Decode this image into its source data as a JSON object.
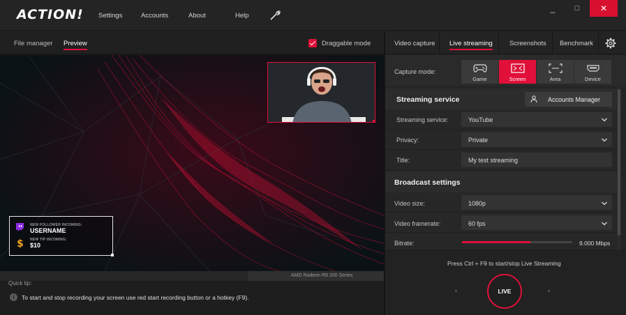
{
  "app": {
    "logo_main": "ACTION",
    "logo_bang": "!",
    "menu": [
      "Settings",
      "Accounts",
      "About",
      "Help"
    ],
    "window_controls": [
      "_",
      "□",
      "✕"
    ]
  },
  "left_tabs": {
    "file_manager": "File manager",
    "preview": "Preview",
    "draggable_mode": "Draggable mode",
    "draggable_checked": true
  },
  "overlay": {
    "follower_label": "NEW FOLLOWER INCOMING:",
    "follower_name": "USERNAME",
    "tip_label": "NEW TIP INCOMING:",
    "tip_value": "$10"
  },
  "gpu_label": "AMD Radeon R9 200 Series",
  "quick_tip": {
    "title": "Quick tip:",
    "text": "To start and stop recording your screen use red start recording button or a hotkey (F9)."
  },
  "right_tabs": [
    "Video capture",
    "Live streaming",
    "Screenshots",
    "Benchmark"
  ],
  "capture_mode": {
    "label": "Capture mode:",
    "options": [
      "Game",
      "Screen",
      "Area",
      "Device"
    ],
    "selected": "Screen"
  },
  "streaming_service_section": {
    "title": "Streaming service",
    "accounts_manager": "Accounts Manager",
    "service_label": "Streaming service:",
    "service_value": "YouTube",
    "privacy_label": "Privacy:",
    "privacy_value": "Private",
    "title_label": "Title:",
    "title_value": "My test streaming"
  },
  "broadcast": {
    "title": "Broadcast settings",
    "video_size_label": "Video size:",
    "video_size_value": "1080p",
    "framerate_label": "Video framerate:",
    "framerate_value": "60 fps",
    "bitrate_label": "Bitrate:",
    "bitrate_value": "9.000 Mbps",
    "bitrate_fraction": 0.62
  },
  "live": {
    "hotkey_text": "Press Ctrl + F9 to start/stop Live Streaming",
    "button_label": "LIVE"
  },
  "colors": {
    "accent": "#e0103a",
    "background": "#1c1c1c"
  }
}
